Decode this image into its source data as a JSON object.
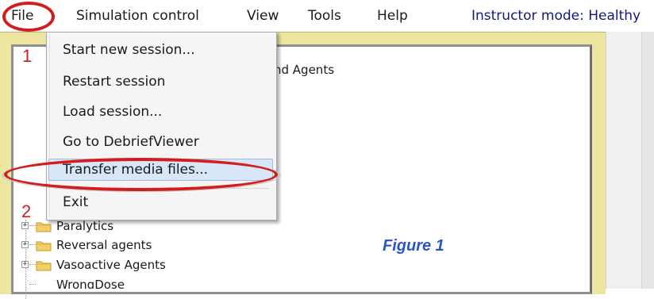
{
  "menubar": {
    "items": [
      "File",
      "Simulation control",
      "View",
      "Tools",
      "Help"
    ],
    "instructor_mode": "Instructor mode: Healthy"
  },
  "file_menu": {
    "items": [
      "Start new session...",
      "Restart session",
      "Load session...",
      "Go to DebriefViewer",
      "Transfer media files...",
      "Exit"
    ],
    "highlighted": "Transfer media files..."
  },
  "tree": {
    "partial_header": "nd Agents",
    "items": [
      "Paralytics",
      "Reversal agents",
      "Vasoactive Agents",
      "WrongDose"
    ]
  },
  "annotations": {
    "step1": "1",
    "step2": "2",
    "figure": "Figure 1",
    "color": "#d41c1c"
  },
  "icons": {
    "folder": "folder-icon",
    "expander": "plus-expander-icon"
  }
}
